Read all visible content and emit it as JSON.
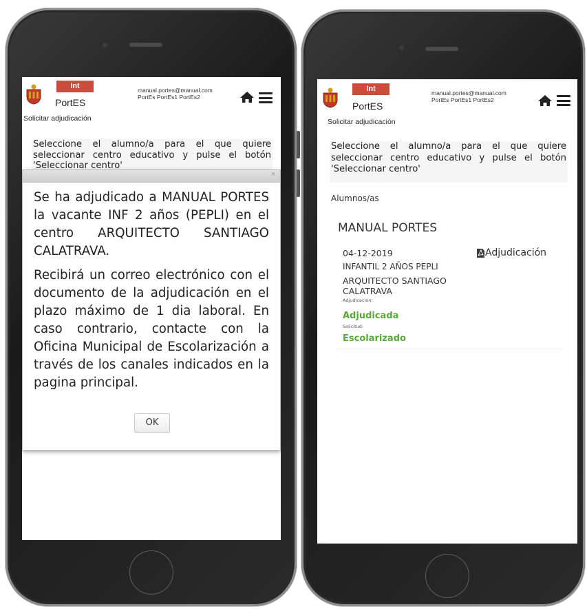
{
  "app": {
    "badge": "Int",
    "brand": "PortES",
    "user_email": "manual.portes@manual.com",
    "user_profiles": "PortEs PortEs1 PortEs2",
    "breadcrumb": "Solicitar adjudicación",
    "instruction": "Seleccione el alumno/a para el que quiere seleccionar centro educativo y pulse el botón 'Seleccionar centro'",
    "instruction_truncated": "botón 'Seleccionar centro'"
  },
  "dialog": {
    "paragraph1": "Se ha adjudicado a MANUAL PORTES la vacante INF 2 años (PEPLI) en el centro ARQUITECTO SANTIAGO CALATRAVA.",
    "paragraph2": "Recibirá un correo electrónico con el documento de la adjudicación en el plazo máximo de 1 dia laboral. En caso contrario, contacte con la Oficina Municipal de Escolarización a través de los canales indicados en la pagina principal.",
    "ok_label": "OK",
    "close_glyph": "×"
  },
  "students": {
    "section_label": "Alumnos/as",
    "student_name": "MANUAL PORTES",
    "date": "04-12-2019",
    "document_link": "Adjudicación",
    "course": "INFANTIL 2 AÑOS PEPLI",
    "school_line1": "ARQUITECTO SANTIAGO",
    "school_line2": "CALATRAVA",
    "adjudicacion_label": "Adjudicacion:",
    "adjudicacion_status": "Adjudicada",
    "solicitud_label": "Solicitud:",
    "solicitud_status": "Escolarizado"
  },
  "colors": {
    "badge_red": "#c94c3c",
    "status_green": "#5aa83a",
    "crest_red": "#c0392b",
    "crest_gold": "#d4a017"
  },
  "icons": [
    "crest-icon",
    "home-icon",
    "hamburger-menu-icon",
    "pdf-icon"
  ]
}
